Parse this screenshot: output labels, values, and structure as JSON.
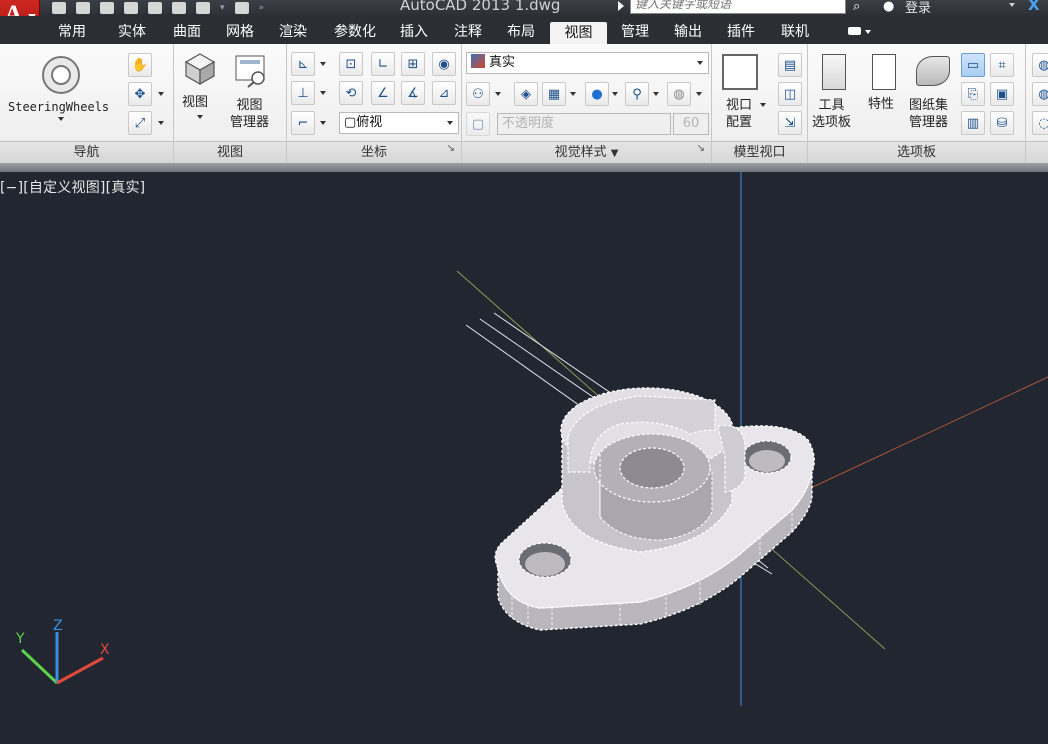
{
  "titlebar": {
    "title": "AutoCAD 2013   1.dwg",
    "search_placeholder": "键入关键字或短语",
    "login": "登录"
  },
  "tabs": [
    "常用",
    "实体",
    "曲面",
    "网格",
    "渲染",
    "参数化",
    "插入",
    "注释",
    "布局",
    "视图",
    "管理",
    "输出",
    "插件",
    "联机"
  ],
  "active_tab": "视图",
  "panels": {
    "navigation": {
      "title": "导航",
      "steeringwheels": "SteeringWheels"
    },
    "views": {
      "title": "视图",
      "view_label": "视图",
      "view_manager_label": "视图\n管理器"
    },
    "coordinates": {
      "title": "坐标",
      "view_combo": "俯视"
    },
    "visual_styles": {
      "title": "视觉样式",
      "style_combo": "真实",
      "opacity_label": "不透明度",
      "opacity_value": "60"
    },
    "model_viewports": {
      "title": "模型视口",
      "viewport_config": "视口\n配置"
    },
    "palettes": {
      "title": "选项板",
      "tool_palettes": "工具\n选项板",
      "properties": "特性",
      "sheet_set_manager": "图纸集\n管理器"
    }
  },
  "viewport": {
    "label": "[−][自定义视图][真实]",
    "ucs": {
      "x": "X",
      "y": "Y",
      "z": "Z"
    }
  },
  "colors": {
    "accent_red": "#c8201a",
    "viewport_bg": "#212630",
    "active_tab_bg": "#f3f3f3"
  }
}
